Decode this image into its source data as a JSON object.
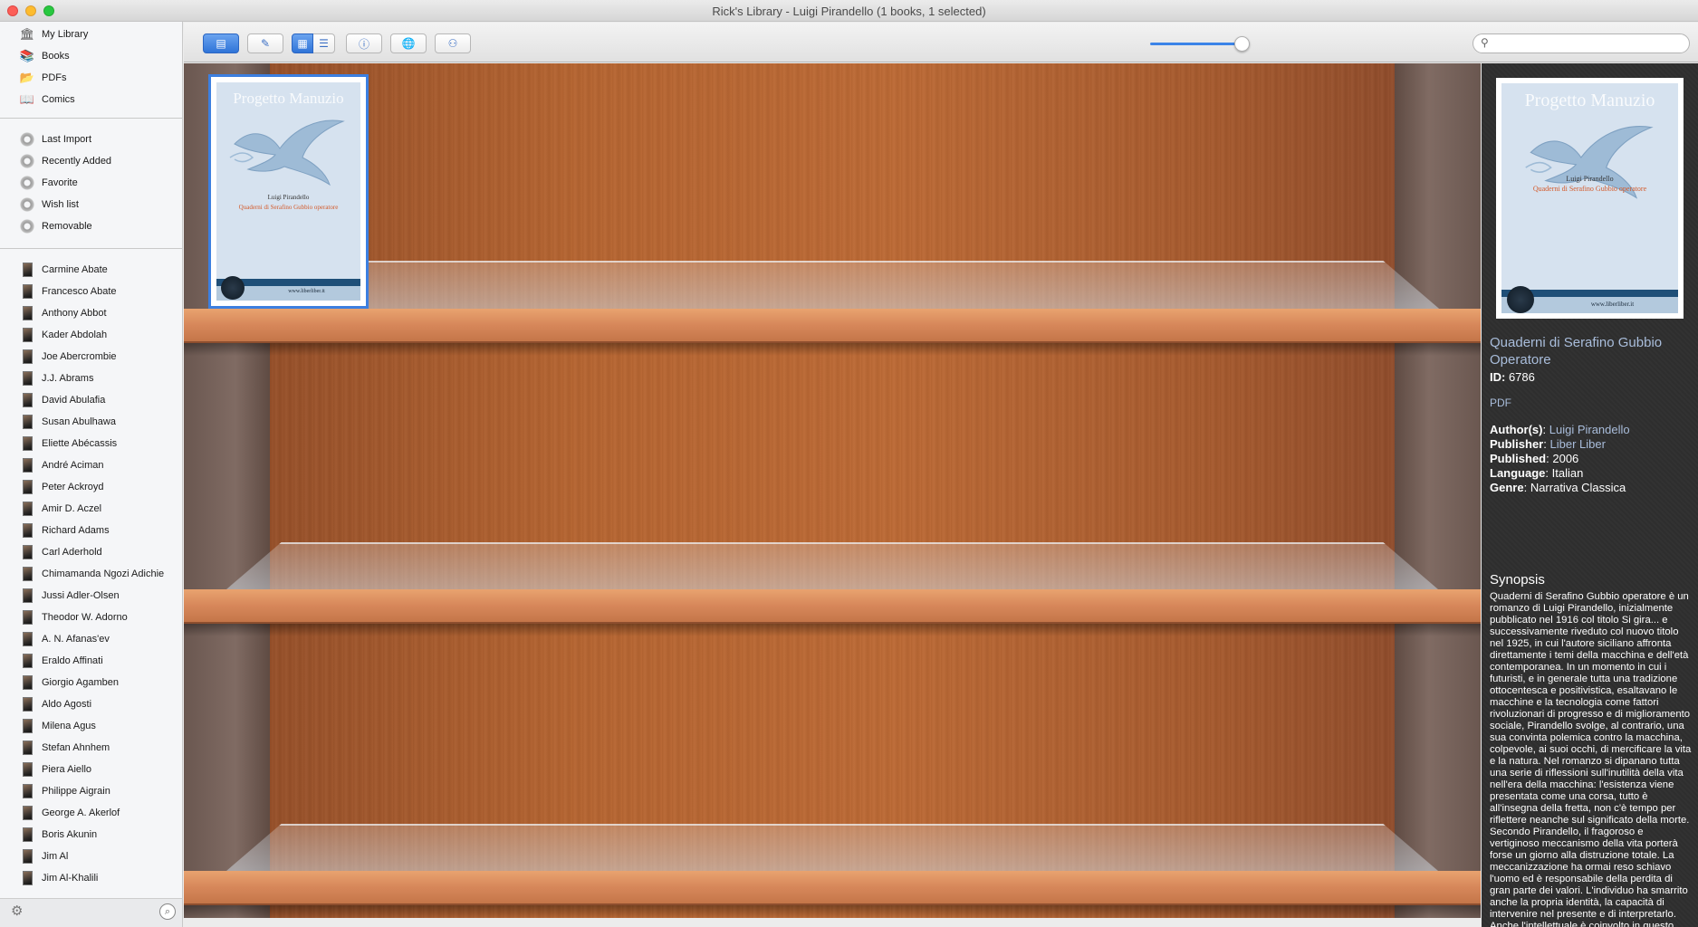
{
  "window": {
    "title": "Rick's Library - Luigi Pirandello (1 books, 1 selected)"
  },
  "sidebar": {
    "library": [
      {
        "label": "My Library",
        "icon": "library-icon"
      },
      {
        "label": "Books",
        "icon": "books-icon"
      },
      {
        "label": "PDFs",
        "icon": "pdf-folder-icon"
      },
      {
        "label": "Comics",
        "icon": "comics-icon"
      }
    ],
    "smart": [
      {
        "label": "Last Import"
      },
      {
        "label": "Recently Added"
      },
      {
        "label": "Favorite"
      },
      {
        "label": "Wish list"
      },
      {
        "label": "Removable"
      }
    ],
    "authors": [
      "Carmine Abate",
      "Francesco Abate",
      "Anthony Abbot",
      "Kader Abdolah",
      "Joe Abercrombie",
      "J.J. Abrams",
      "David Abulafia",
      "Susan Abulhawa",
      "Eliette Abécassis",
      "André Aciman",
      "Peter Ackroyd",
      "Amir D. Aczel",
      "Richard Adams",
      "Carl Aderhold",
      "Chimamanda Ngozi Adichie",
      "Jussi Adler-Olsen",
      "Theodor W. Adorno",
      "A. N. Afanas'ev",
      "Eraldo Affinati",
      "Giorgio Agamben",
      "Aldo Agosti",
      "Milena Agus",
      "Stefan Ahnhem",
      "Piera Aiello",
      "Philippe Aigrain",
      "George A. Akerlof",
      "Boris Akunin",
      "Jim Al",
      "Jim Al-Khalili"
    ]
  },
  "toolbar": {
    "zoom_level": 0.92,
    "search": {
      "value": "",
      "placeholder": ""
    }
  },
  "book": {
    "cover_series": "Progetto Manuzio",
    "cover_author": "Luigi Pirandello",
    "cover_title": "Quaderni di Serafino Gubbio operatore",
    "cover_url": "www.liberliber.it"
  },
  "info": {
    "title": "Quaderni di Serafino Gubbio Operatore",
    "id_label": "ID",
    "id_value": "6786",
    "format": "PDF",
    "author_label": "Author(s)",
    "author": "Luigi Pirandello",
    "publisher_label": "Publisher",
    "publisher": "Liber Liber",
    "published_label": "Published",
    "published": "2006",
    "language_label": "Language",
    "language": "Italian",
    "genre_label": "Genre",
    "genre": "Narrativa Classica",
    "synopsis_heading": "Synopsis",
    "synopsis": "Quaderni di Serafino Gubbio operatore è un romanzo di Luigi Pirandello, inizialmente pubblicato nel 1916 col titolo Si gira... e successivamente riveduto col nuovo titolo nel 1925, in cui l'autore siciliano affronta direttamente i temi della macchina e dell'età contemporanea. In un momento in cui i futuristi, e in generale tutta una tradizione ottocentesca e positivistica, esaltavano le macchine e la tecnologia come fattori rivoluzionari di progresso e di miglioramento sociale, Pirandello svolge, al contrario, una sua convinta polemica contro la macchina, colpevole, ai suoi occhi, di mercificare la vita e la natura. Nel romanzo si dipanano tutta una serie di riflessioni sull'inutilità della vita nell'era della macchina: l'esistenza viene presentata come una corsa, tutto è all'insegna della fretta, non c'è tempo per riflettere neanche sul significato della morte. Secondo Pirandello, il fragoroso e vertiginoso meccanismo della vita porterà forse un giorno alla distruzione totale. La meccanizzazione ha ormai reso schiavo l'uomo ed è responsabile della perdita di gran parte dei valori. L'individuo ha smarrito anche la propria identità, la capacità di intervenire nel presente e di interpretarlo. Anche l'intellettuale è coinvolto in questo processo"
  },
  "colors": {
    "accent": "#3c7fe0",
    "link": "#a9bddb",
    "panel": "#2f2f2f"
  }
}
